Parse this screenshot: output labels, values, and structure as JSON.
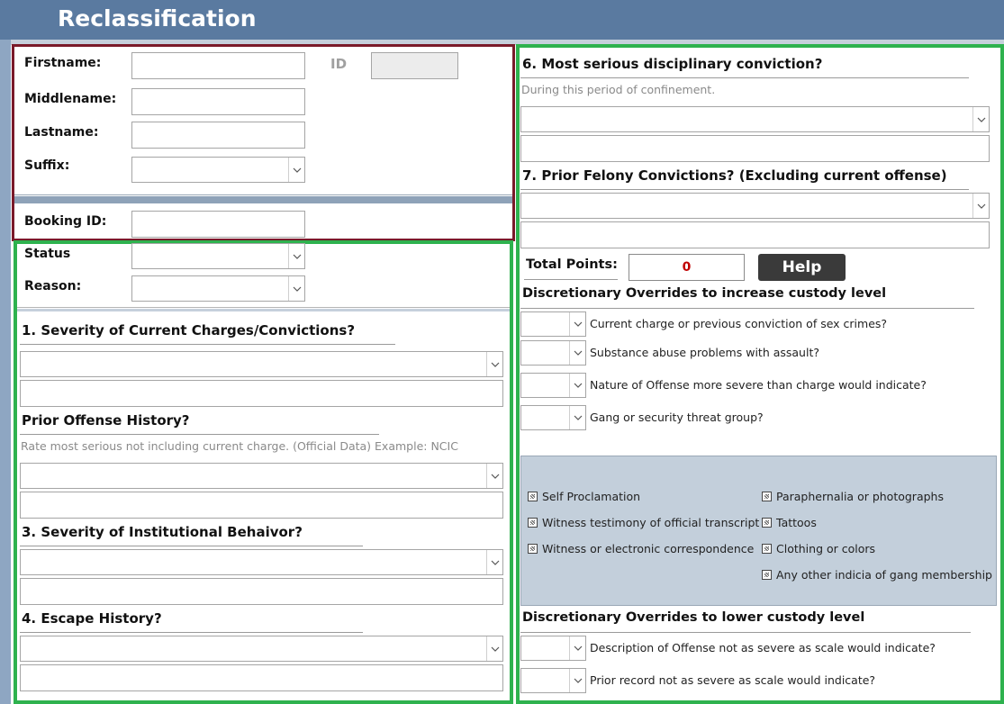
{
  "header": {
    "title": "Reclassification"
  },
  "identity": {
    "firstname_label": "Firstname:",
    "middlename_label": "Middlename:",
    "lastname_label": "Lastname:",
    "suffix_label": "Suffix:",
    "id_label": "ID",
    "booking_label": "Booking ID:",
    "firstname_value": "",
    "middlename_value": "",
    "lastname_value": "",
    "suffix_value": "",
    "id_value": "",
    "booking_value": ""
  },
  "status": {
    "status_label": "Status",
    "reason_label": "Reason:",
    "status_value": "",
    "reason_value": ""
  },
  "questions": {
    "q1_label": "1. Severity of Current Charges/Convictions?",
    "q2_label": "Prior Offense History?",
    "q2_hint": "Rate most serious not including current charge. (Official Data) Example: NCIC",
    "q3_label": "3. Severity of Institutional Behaivor?",
    "q4_label": "4. Escape History?",
    "q6_label": "6. Most serious disciplinary conviction?",
    "q6_hint": "During this period of confinement.",
    "q7_label": "7. Prior Felony Convictions? (Excluding current offense)"
  },
  "totals": {
    "total_label": "Total Points:",
    "total_value": "0",
    "help_label": "Help"
  },
  "overrides_increase": {
    "heading": "Discretionary Overrides to increase custody level",
    "items": [
      "Current charge or previous conviction of sex crimes?",
      "Substance abuse problems with assault?",
      "Nature of Offense more severe than charge would indicate?",
      "Gang or security threat group?"
    ]
  },
  "gang_indicators": {
    "left": [
      "Self Proclamation",
      "Witness testimony of official transcript",
      "Witness or electronic correspondence"
    ],
    "right": [
      "Paraphernalia or photographs",
      "Tattoos",
      "Clothing or colors",
      "Any other indicia of gang membership"
    ]
  },
  "overrides_lower": {
    "heading": "Discretionary Overrides to lower custody level",
    "items": [
      "Description of Offense not as severe as scale would indicate?",
      "Prior record not as severe as scale would indicate?"
    ]
  },
  "colors": {
    "titlebar": "#5a7aa0",
    "maroon_border": "#7a1a2a",
    "green_border": "#2eb24e",
    "points_text": "#c00000",
    "gang_panel": "#c3cfdb"
  }
}
